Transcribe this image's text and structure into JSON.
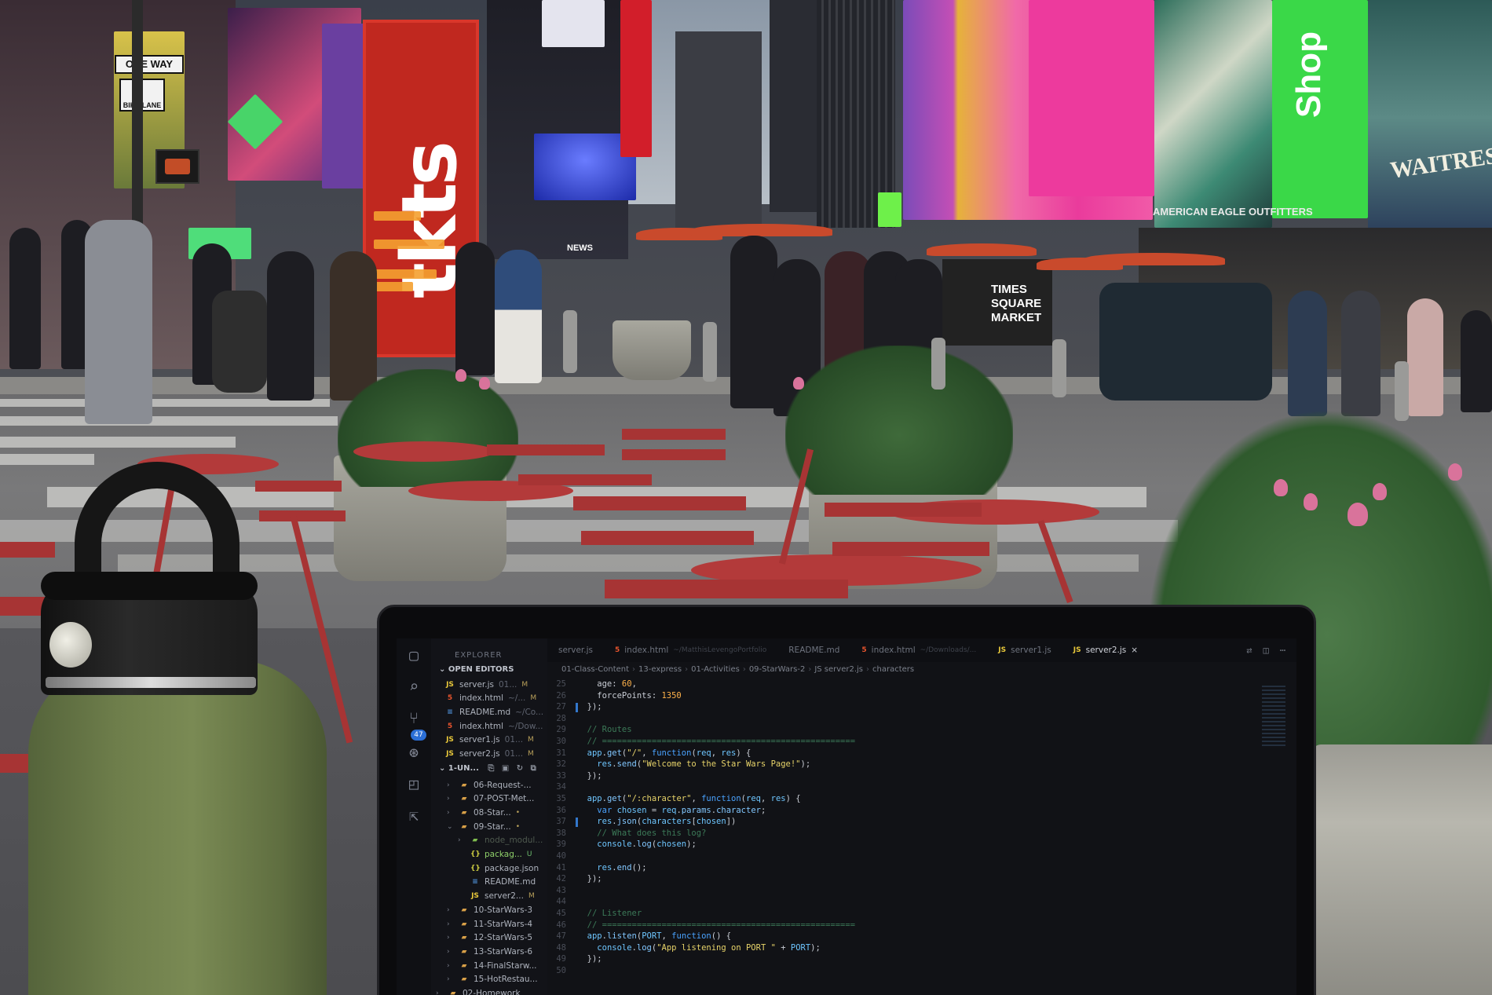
{
  "scene": {
    "tkts_sign": "tkts",
    "street_signs": {
      "one_way": "ONE WAY",
      "bike_lane": "BIKE LANE"
    },
    "billboards": {
      "shop": "Shop",
      "waitress": "WAITRESS",
      "american_eagle": "AMERICAN EAGLE OUTFITTERS",
      "times_square_market": "TIMES SQUARE MARKET",
      "news": "NEWS"
    }
  },
  "vscode": {
    "explorer_title": "EXPLORER",
    "open_editors_label": "OPEN EDITORS",
    "scm_badge": "47",
    "open_editors": [
      {
        "icon": "JS",
        "type": "js",
        "name": "server.js",
        "muted": "01...",
        "badge": "M"
      },
      {
        "icon": "5",
        "type": "html",
        "name": "index.html",
        "muted": "~/...",
        "badge": "M"
      },
      {
        "icon": "",
        "type": "md",
        "name": "README.md",
        "muted": "~/Co...",
        "badge": ""
      },
      {
        "icon": "5",
        "type": "html",
        "name": "index.html",
        "muted": "~/Dow...",
        "badge": ""
      },
      {
        "icon": "JS",
        "type": "js",
        "name": "server1.js",
        "muted": "01...",
        "badge": "M"
      },
      {
        "icon": "JS",
        "type": "js",
        "name": "server2.js",
        "muted": "01...",
        "badge": "M"
      }
    ],
    "workspace_label": "1-UN...",
    "tree": [
      {
        "indent": 1,
        "chev": "›",
        "type": "folder",
        "name": "06-Request-...",
        "badge": ""
      },
      {
        "indent": 1,
        "chev": "›",
        "type": "folder",
        "name": "07-POST-Met...",
        "badge": ""
      },
      {
        "indent": 1,
        "chev": "›",
        "type": "folder",
        "name": "08-Star...",
        "badge": "•"
      },
      {
        "indent": 1,
        "chev": "⌄",
        "type": "folder",
        "name": "09-Star...",
        "badge": "•"
      },
      {
        "indent": 2,
        "chev": "›",
        "type": "node",
        "name": "node_modul...",
        "badge": ""
      },
      {
        "indent": 2,
        "chev": "",
        "type": "json",
        "name": "packag...",
        "badge": "U"
      },
      {
        "indent": 2,
        "chev": "",
        "type": "json",
        "name": "package.json",
        "badge": ""
      },
      {
        "indent": 2,
        "chev": "",
        "type": "md",
        "name": "README.md",
        "badge": ""
      },
      {
        "indent": 2,
        "chev": "",
        "type": "js",
        "name": "server2...",
        "badge": "M"
      },
      {
        "indent": 1,
        "chev": "›",
        "type": "folder",
        "name": "10-StarWars-3",
        "badge": ""
      },
      {
        "indent": 1,
        "chev": "›",
        "type": "folder",
        "name": "11-StarWars-4",
        "badge": ""
      },
      {
        "indent": 1,
        "chev": "›",
        "type": "folder",
        "name": "12-StarWars-5",
        "badge": ""
      },
      {
        "indent": 1,
        "chev": "›",
        "type": "folder",
        "name": "13-StarWars-6",
        "badge": ""
      },
      {
        "indent": 1,
        "chev": "›",
        "type": "folder",
        "name": "14-FinalStarw...",
        "badge": ""
      },
      {
        "indent": 1,
        "chev": "›",
        "type": "folder",
        "name": "15-HotRestau...",
        "badge": ""
      },
      {
        "indent": 0,
        "chev": "›",
        "type": "folder",
        "name": "02-Homework",
        "badge": ""
      }
    ],
    "tabs": [
      {
        "icon": "",
        "name": "server.js",
        "sub": "",
        "active": false
      },
      {
        "icon": "5",
        "name": "index.html",
        "sub": "~/MatthisLevengoPortfolio",
        "active": false
      },
      {
        "icon": "",
        "name": "README.md",
        "sub": "",
        "active": false
      },
      {
        "icon": "5",
        "name": "index.html",
        "sub": "~/Downloads/...",
        "active": false
      },
      {
        "icon": "JS",
        "name": "server1.js",
        "sub": "",
        "active": false
      },
      {
        "icon": "JS",
        "name": "server2.js",
        "sub": "",
        "active": true
      }
    ],
    "breadcrumb": [
      "01-Class-Content",
      "13-express",
      "01-Activities",
      "09-StarWars-2",
      "JS server2.js",
      "characters"
    ],
    "code_lines": [
      {
        "n": "25",
        "html": "    age: 60,"
      },
      {
        "n": "26",
        "html": "    forcePoints: 1350"
      },
      {
        "n": "27",
        "html": "  });"
      },
      {
        "n": "28",
        "html": ""
      },
      {
        "n": "29",
        "html": "  // Routes"
      },
      {
        "n": "30",
        "html": "  // ==================================================="
      },
      {
        "n": "31",
        "html": "  app.get(\"/\", function(req, res) {"
      },
      {
        "n": "32",
        "html": "    res.send(\"Welcome to the Star Wars Page!\");"
      },
      {
        "n": "33",
        "html": "  });"
      },
      {
        "n": "34",
        "html": ""
      },
      {
        "n": "35",
        "html": "  app.get(\"/:character\", function(req, res) {"
      },
      {
        "n": "36",
        "html": "    var chosen = req.params.character;"
      },
      {
        "n": "37",
        "html": "    res.json(characters[chosen])"
      },
      {
        "n": "38",
        "html": "    // What does this log?"
      },
      {
        "n": "39",
        "html": "    console.log(chosen);"
      },
      {
        "n": "40",
        "html": ""
      },
      {
        "n": "41",
        "html": "    res.end();"
      },
      {
        "n": "42",
        "html": "  });"
      },
      {
        "n": "43",
        "html": ""
      },
      {
        "n": "44",
        "html": ""
      },
      {
        "n": "45",
        "html": "  // Listener"
      },
      {
        "n": "46",
        "html": "  // ==================================================="
      },
      {
        "n": "47",
        "html": "  app.listen(PORT, function() {"
      },
      {
        "n": "48",
        "html": "    console.log(\"App listening on PORT \" + PORT);"
      },
      {
        "n": "49",
        "html": "  });"
      },
      {
        "n": "50",
        "html": ""
      }
    ]
  }
}
